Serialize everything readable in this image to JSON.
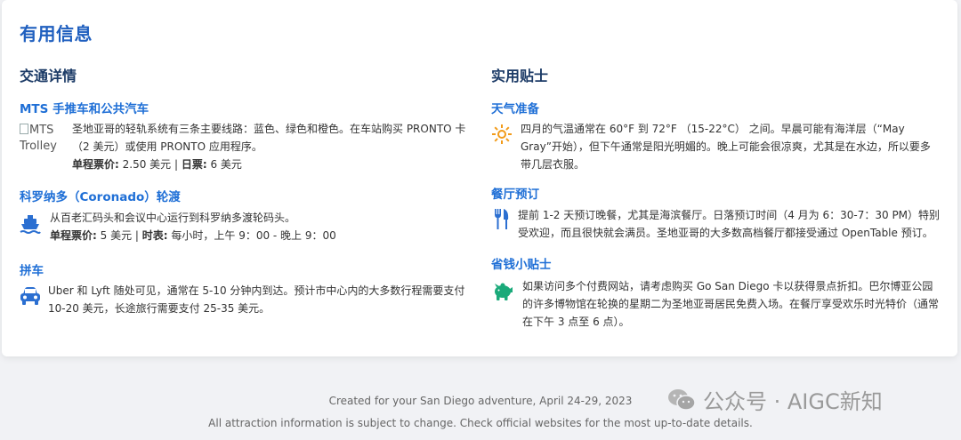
{
  "card": {
    "title": "有用信息"
  },
  "transport": {
    "heading": "交通详情",
    "items": [
      {
        "title": "MTS 手推车和公共汽车",
        "image_alt": "MTS Trolley",
        "text": "圣地亚哥的轻轨系统有三条主要线路：蓝色、绿色和橙色。在车站购买 PRONTO 卡（2 美元）或使用 PRONTO 应用程序。",
        "meta_label_1": "单程票价:",
        "meta_value_1": " 2.50 美元 | ",
        "meta_label_2": "日票:",
        "meta_value_2": " 6 美元"
      },
      {
        "title": "科罗纳多（Coronado）轮渡",
        "icon": "ship-icon",
        "text": "从百老汇码头和会议中心运行到科罗纳多渡轮码头。",
        "meta_label_1": "单程票价:",
        "meta_value_1": " 5 美元 | ",
        "meta_label_2": "时表:",
        "meta_value_2": " 每小时，上午 9：00 - 晚上 9：00"
      },
      {
        "title": "拼车",
        "icon": "car-icon",
        "text": "Uber 和 Lyft 随处可见，通常在 5-10 分钟内到达。预计市中心内的大多数行程需要支付 10-20 美元，长途旅行需要支付 25-35 美元。"
      }
    ]
  },
  "tips": {
    "heading": "实用贴士",
    "items": [
      {
        "title": "天气准备",
        "icon": "sun-icon",
        "text": "四月的气温通常在 60°F 到 72°F （15-22°C） 之间。早晨可能有海洋层（“May Gray”开始），但下午通常是阳光明媚的。晚上可能会很凉爽，尤其是在水边，所以要多带几层衣服。"
      },
      {
        "title": "餐厅预订",
        "icon": "utensils-icon",
        "text": "提前 1-2 天预订晚餐，尤其是海滨餐厅。日落预订时间（4 月为 6：30-7：30 PM）特别受欢迎，而且很快就会满员。圣地亚哥的大多数高档餐厅都接受通过 OpenTable 预订。"
      },
      {
        "title": "省钱小贴士",
        "icon": "piggy-bank-icon",
        "text": "如果访问多个付费网站，请考虑购买 Go San Diego 卡以获得景点折扣。巴尔博亚公园的许多博物馆在轮换的星期二为圣地亚哥居民免费入场。在餐厅享受欢乐时光特价（通常在下午 3 点至 6 点）。"
      }
    ]
  },
  "footer": {
    "line1": "Created for your San Diego adventure, April 24-29, 2023",
    "line2": "All attraction information is subject to change. Check official websites for the most up-to-date details."
  },
  "watermark": {
    "icon": "wechat-icon",
    "text": "公众号 · AIGC新知"
  },
  "colors": {
    "title_blue": "#1f5fbf",
    "item_blue": "#1f6fd6",
    "icon_blue": "#2b6fd1",
    "sun_orange": "#f29b1a",
    "piggy_green": "#1aaa7a"
  }
}
